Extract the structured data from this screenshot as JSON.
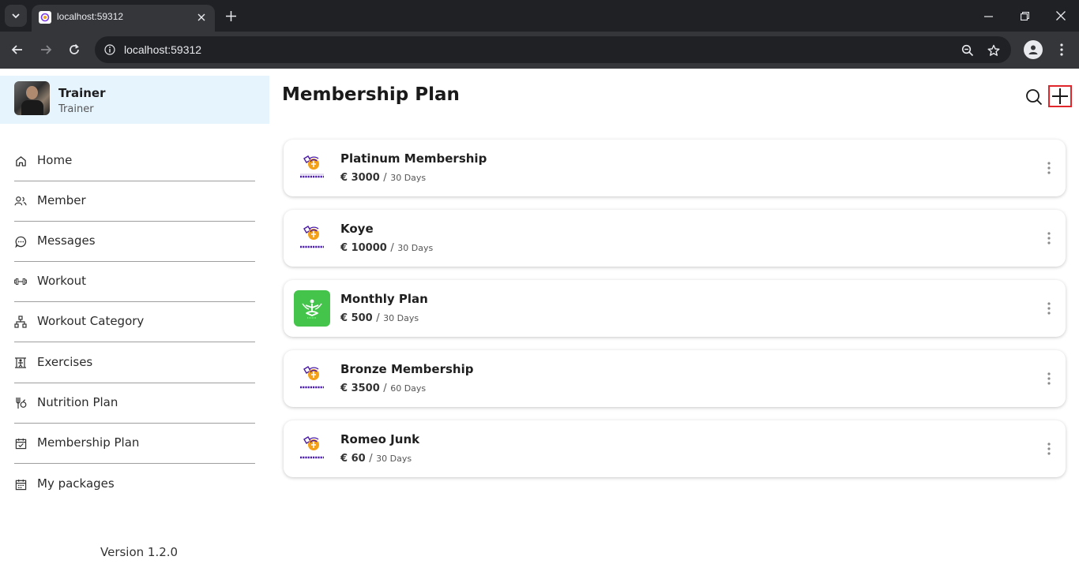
{
  "browser": {
    "tab_title": "localhost:59312",
    "url": "localhost:59312"
  },
  "sidebar": {
    "profile": {
      "name": "Trainer",
      "role": "Trainer"
    },
    "items": [
      {
        "label": "Home",
        "icon": "home-icon"
      },
      {
        "label": "Member",
        "icon": "users-icon"
      },
      {
        "label": "Messages",
        "icon": "chat-icon"
      },
      {
        "label": "Workout",
        "icon": "dumbbell-icon"
      },
      {
        "label": "Workout Category",
        "icon": "hierarchy-icon"
      },
      {
        "label": "Exercises",
        "icon": "exercise-icon"
      },
      {
        "label": "Nutrition Plan",
        "icon": "nutrition-icon"
      },
      {
        "label": "Membership Plan",
        "icon": "calendar-check-icon"
      },
      {
        "label": "My packages",
        "icon": "calendar-icon"
      }
    ],
    "version": "Version 1.2.0"
  },
  "main": {
    "title": "Membership Plan",
    "plans": [
      {
        "name": "Platinum Membership",
        "price": "€ 3000",
        "separator": "/",
        "duration": "30 Days",
        "logo": "crossfit-logo"
      },
      {
        "name": "Koye",
        "price": "€ 10000",
        "separator": "/",
        "duration": "30 Days",
        "logo": "crossfit-logo"
      },
      {
        "name": "Monthly Plan",
        "price": "€ 500",
        "separator": "/",
        "duration": "30 Days",
        "logo": "yoga-logo"
      },
      {
        "name": "Bronze Membership",
        "price": "€ 3500",
        "separator": "/",
        "duration": "60 Days",
        "logo": "crossfit-logo"
      },
      {
        "name": "Romeo Junk",
        "price": "€ 60",
        "separator": "/",
        "duration": "30 Days",
        "logo": "crossfit-logo"
      }
    ]
  },
  "colors": {
    "accent_highlight": "#e0262b",
    "profile_bg": "#e6f4fd",
    "logo_purple": "#4a1ba8",
    "logo_orange": "#f4a11a",
    "logo_green": "#45c44c"
  }
}
